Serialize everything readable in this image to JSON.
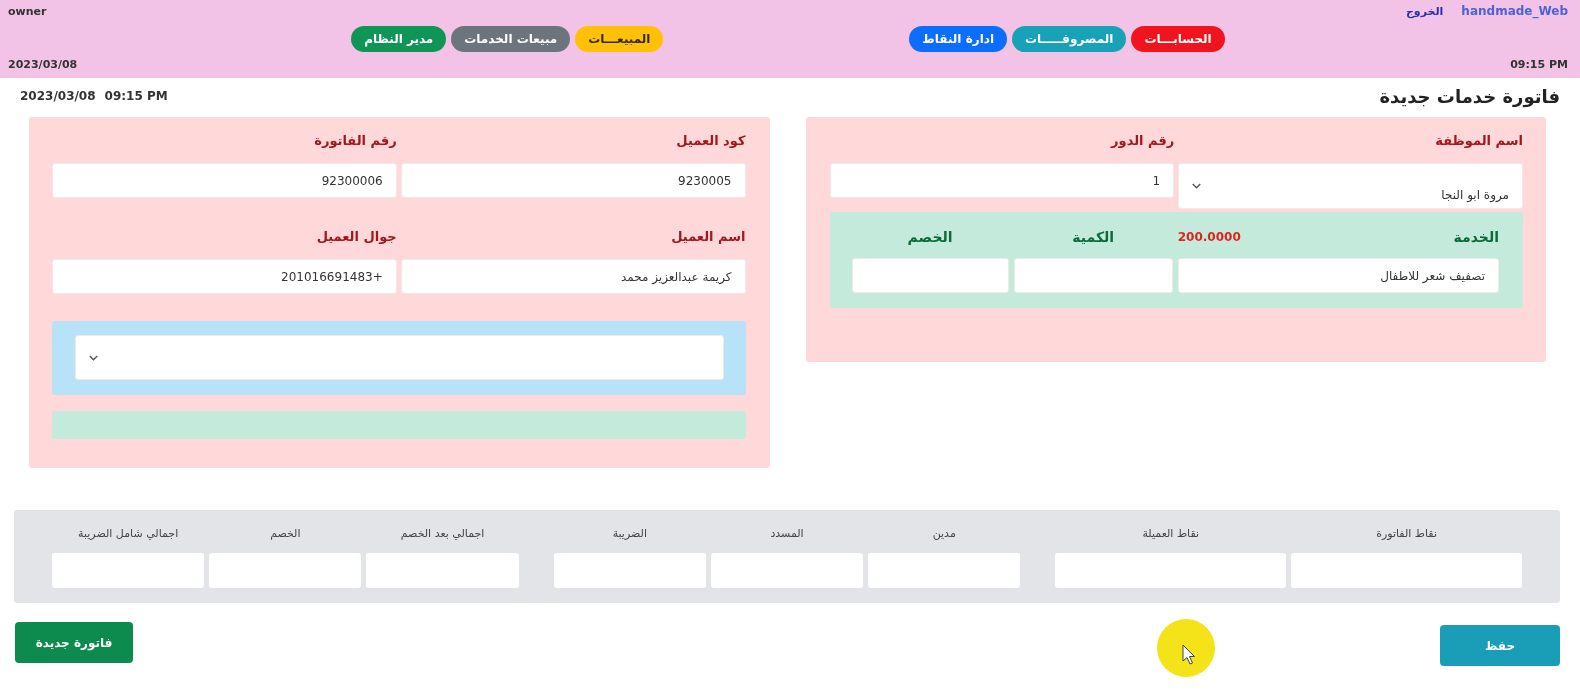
{
  "top_bar": {
    "brand": "handmade_Web",
    "logout": "الخروج",
    "user": "owner",
    "nav_groups": [
      {
        "items": [
          {
            "label": "الحسابـــات",
            "color": "#f0141e"
          },
          {
            "label": "المصروفـــــات",
            "color": "#17a2b8"
          },
          {
            "label": "ادارة النقاط",
            "color": "#0d6efd"
          }
        ]
      },
      {
        "items": [
          {
            "label": "المبيعـــات",
            "color": "#ffc107"
          },
          {
            "label": "مبيعات الخدمات",
            "color": "#6c757d"
          },
          {
            "label": "مدير النظام",
            "color": "#0f9657"
          }
        ]
      }
    ],
    "time": "09:15 PM",
    "date": "2023/03/08"
  },
  "page_header": {
    "title": "فاتورة خدمات جديدة",
    "date": "2023/03/08",
    "time": "09:15 PM"
  },
  "employee_panel": {
    "fields": [
      {
        "label": "اسم الموظفة",
        "kind": "select",
        "value": "مروة ابو النجا"
      },
      {
        "label": "رقم الدور",
        "kind": "input",
        "value": "1"
      }
    ],
    "service_section": {
      "price": "200.0000",
      "columns": [
        {
          "label": "الخدمة",
          "value": "تصفيف شعر للاطفال"
        },
        {
          "label": "الكمية"
        },
        {
          "label": "الخصم"
        }
      ]
    }
  },
  "customer_panel": {
    "fields": [
      {
        "label": "كود العميل",
        "value": "9230005"
      },
      {
        "label": "رقم الفاتورة",
        "value": "92300006"
      },
      {
        "label": "اسم العميل",
        "value": "كريمة عبدالعزيز محمد"
      },
      {
        "label": "جوال العميل",
        "value": "+201016691483"
      }
    ]
  },
  "totals": {
    "groups": [
      [
        {
          "label": "نقاط الفاتورة"
        },
        {
          "label": "نقاط العميلة"
        }
      ],
      [
        {
          "label": "مدين"
        },
        {
          "label": "المسدد"
        },
        {
          "label": "الضريبة"
        }
      ],
      [
        {
          "label": "اجمالي بعد الخصم"
        },
        {
          "label": "الخصم"
        },
        {
          "label": "اجمالي شامل الضريبة"
        }
      ]
    ]
  },
  "actions": [
    {
      "label": "حفظ",
      "kind": "save"
    },
    {
      "label": "فاتورة جديدة",
      "kind": "new"
    }
  ]
}
